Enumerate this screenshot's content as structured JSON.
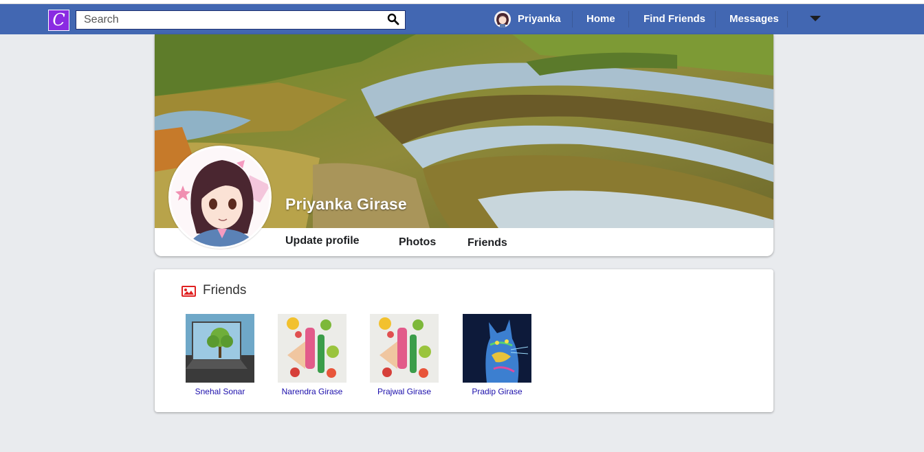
{
  "nav": {
    "logo_letter": "C",
    "search_placeholder": "Search",
    "user_name": "Priyanka",
    "links": [
      "Home",
      "Find Friends",
      "Messages"
    ]
  },
  "profile": {
    "full_name": "Priyanka Girase",
    "tabs": [
      "Update profile",
      "Photos",
      "Friends"
    ]
  },
  "friends_section": {
    "title": "Friends",
    "friends": [
      {
        "name": "Snehal Sonar",
        "thumb": "landscape-tree"
      },
      {
        "name": "Narendra Girase",
        "thumb": "fruit-drinks"
      },
      {
        "name": "Prajwal Girase",
        "thumb": "fruit-drinks"
      },
      {
        "name": "Pradip Girase",
        "thumb": "neon-cat"
      }
    ]
  },
  "colors": {
    "navbar": "#4267b2",
    "logo": "#8a2be2",
    "friend_link": "#1a0dab",
    "friends_icon": "#e02020"
  }
}
